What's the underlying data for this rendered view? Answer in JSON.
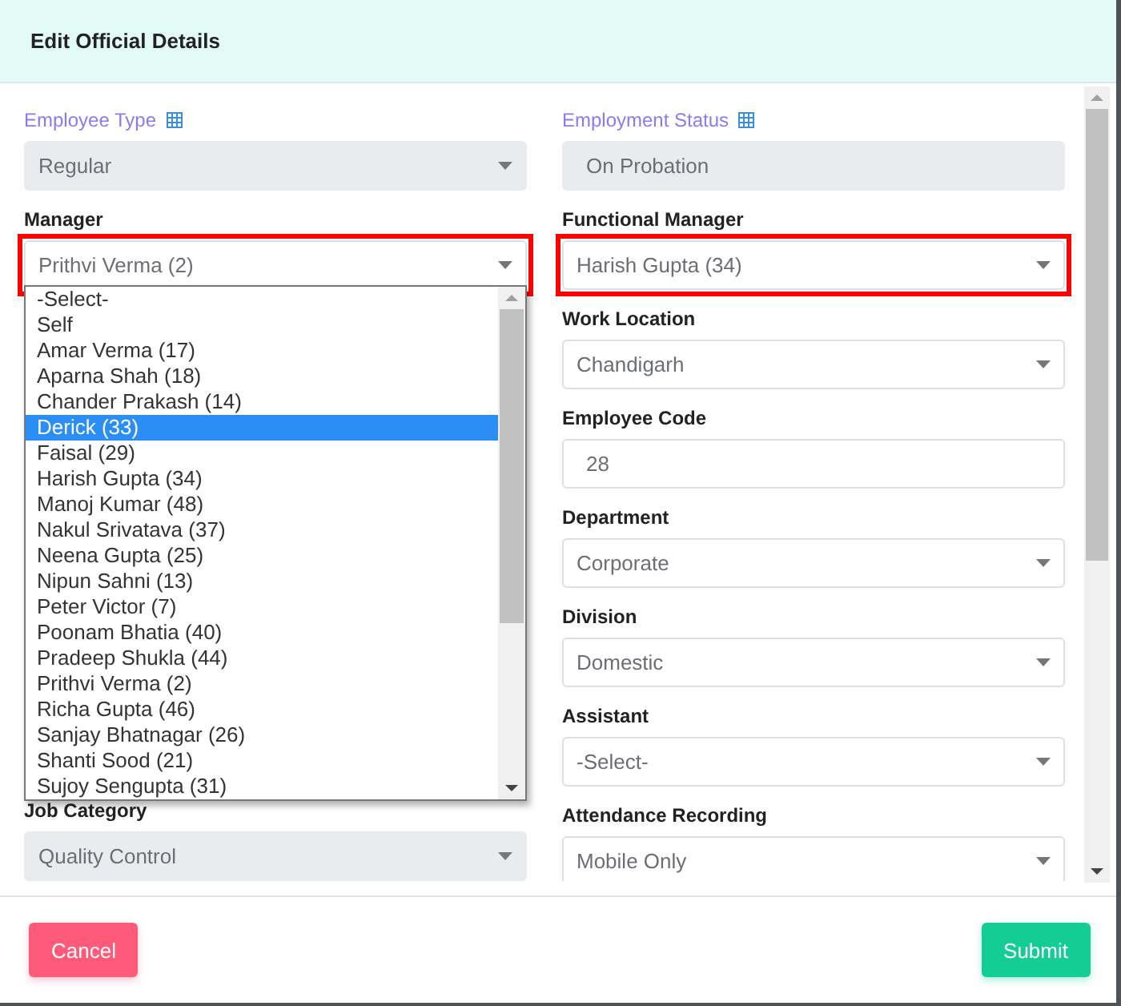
{
  "dialog": {
    "title": "Edit Official Details"
  },
  "left_fields": [
    {
      "label": "Employee Type",
      "kind": "select",
      "value": "Regular",
      "disabled": true,
      "info_icon": true,
      "highlighted": false
    },
    {
      "label": "Manager",
      "kind": "select",
      "value": "Prithvi Verma (2)",
      "disabled": false,
      "info_icon": false,
      "highlighted": true,
      "open": true,
      "options": [
        {
          "label": "-Select-",
          "highlighted": false
        },
        {
          "label": "Self",
          "highlighted": false
        },
        {
          "label": "Amar Verma (17)",
          "highlighted": false
        },
        {
          "label": "Aparna Shah (18)",
          "highlighted": false
        },
        {
          "label": "Chander Prakash (14)",
          "highlighted": false
        },
        {
          "label": "Derick (33)",
          "highlighted": true
        },
        {
          "label": "Faisal (29)",
          "highlighted": false
        },
        {
          "label": "Harish Gupta (34)",
          "highlighted": false
        },
        {
          "label": "Manoj Kumar (48)",
          "highlighted": false
        },
        {
          "label": "Nakul Srivatava (37)",
          "highlighted": false
        },
        {
          "label": "Neena Gupta (25)",
          "highlighted": false
        },
        {
          "label": "Nipun Sahni (13)",
          "highlighted": false
        },
        {
          "label": "Peter Victor (7)",
          "highlighted": false
        },
        {
          "label": "Poonam Bhatia (40)",
          "highlighted": false
        },
        {
          "label": "Pradeep Shukla (44)",
          "highlighted": false
        },
        {
          "label": "Prithvi Verma (2)",
          "highlighted": false
        },
        {
          "label": "Richa Gupta (46)",
          "highlighted": false
        },
        {
          "label": "Sanjay Bhatnagar (26)",
          "highlighted": false
        },
        {
          "label": "Shanti Sood (21)",
          "highlighted": false
        },
        {
          "label": "Sujoy Sengupta (31)",
          "highlighted": false
        }
      ]
    },
    {
      "label": "Job Category",
      "kind": "select",
      "value": "Quality Control",
      "disabled": true,
      "info_icon": false,
      "highlighted": false
    }
  ],
  "right_fields": [
    {
      "label": "Employment Status",
      "kind": "input",
      "value": "On Probation",
      "disabled": true,
      "info_icon": true,
      "highlighted": false
    },
    {
      "label": "Functional Manager",
      "kind": "select",
      "value": "Harish Gupta (34)",
      "disabled": false,
      "info_icon": false,
      "highlighted": true
    },
    {
      "label": "Work Location",
      "kind": "select",
      "value": "Chandigarh",
      "disabled": false,
      "info_icon": false,
      "highlighted": false
    },
    {
      "label": "Employee Code",
      "kind": "input",
      "value": "28",
      "disabled": false,
      "info_icon": false,
      "highlighted": false
    },
    {
      "label": "Department",
      "kind": "select",
      "value": "Corporate",
      "disabled": false,
      "info_icon": false,
      "highlighted": false
    },
    {
      "label": "Division",
      "kind": "select",
      "value": "Domestic",
      "disabled": false,
      "info_icon": false,
      "highlighted": false
    },
    {
      "label": "Assistant",
      "kind": "select",
      "value": "-Select-",
      "disabled": false,
      "info_icon": false,
      "highlighted": false
    },
    {
      "label": "Attendance Recording",
      "kind": "select",
      "value": "Mobile Only",
      "disabled": false,
      "info_icon": false,
      "highlighted": false
    }
  ],
  "buttons": [
    {
      "label": "Cancel",
      "kind": "cancel"
    },
    {
      "label": "Submit",
      "kind": "submit"
    }
  ]
}
